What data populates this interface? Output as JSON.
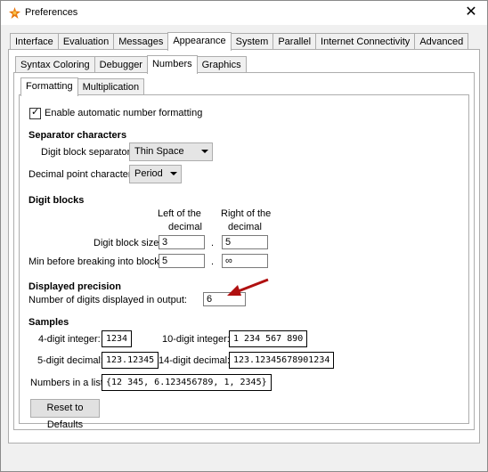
{
  "window": {
    "title": "Preferences",
    "close_label": "✕"
  },
  "main_tabs": [
    "Interface",
    "Evaluation",
    "Messages",
    "Appearance",
    "System",
    "Parallel",
    "Internet Connectivity",
    "Advanced"
  ],
  "sub_tabs": [
    "Syntax Coloring",
    "Debugger",
    "Numbers",
    "Graphics"
  ],
  "inner_tabs": [
    "Formatting",
    "Multiplication"
  ],
  "enable_formatting": {
    "label": "Enable automatic number formatting",
    "checked": true,
    "mark": "✓"
  },
  "separator": {
    "heading": "Separator characters",
    "digit_block_label": "Digit block separator:",
    "digit_block_value": "Thin Space",
    "decimal_label": "Decimal point character:",
    "decimal_value": "Period"
  },
  "digit_blocks": {
    "heading": "Digit blocks",
    "left_header_1": "Left of the",
    "left_header_2": "decimal",
    "right_header_1": "Right of the",
    "right_header_2": "decimal",
    "size_label": "Digit block size:",
    "size_left": "3",
    "size_right": "5",
    "min_label": "Min before breaking into blocks:",
    "min_left": "5",
    "min_right": "∞",
    "dot": "."
  },
  "precision": {
    "heading": "Displayed precision",
    "label": "Number of digits displayed in output:",
    "value": "6"
  },
  "samples": {
    "heading": "Samples",
    "int4_label": "4-digit integer:",
    "int4_value": "1234",
    "int10_label": "10-digit integer:",
    "int10_value": "1 234 567 890",
    "dec5_label": "5-digit decimal:",
    "dec5_value": "123.12345",
    "dec14_label": "14-digit decimal:",
    "dec14_value": "123.12345678901234",
    "list_label": "Numbers in a list:",
    "list_value": "{12 345, 6.123456789, 1, 2345}"
  },
  "reset_label": "Reset to Defaults",
  "colors": {
    "arrow": "#b01010",
    "panel_bg": "#ffffff",
    "window_bg": "#f0f0f0"
  }
}
